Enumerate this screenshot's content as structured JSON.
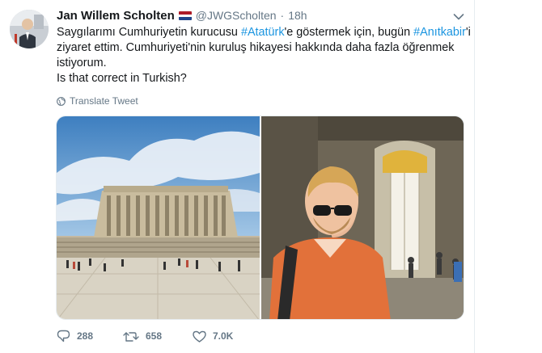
{
  "tweet": {
    "author_name": "Jan Willem Scholten",
    "handle": "@JWGScholten",
    "separator": "·",
    "time": "18h",
    "text": {
      "line1_a": "Saygılarımı Cumhuriyetin kurucusu ",
      "hashtag1": "#Atatürk",
      "line1_b": "'e göstermek için, bugün ",
      "hashtag2": "#Anıtkabir",
      "line1_c": "'i",
      "line2": "ziyaret ettim. Cumhuriyeti'nin kuruluş hikayesi hakkında daha fazla öğrenmek",
      "line3": "istiyorum.",
      "line4": "Is that correct in Turkish?"
    },
    "translate_label": "Translate Tweet",
    "media": [
      {
        "icon": "photo-anitkabir-exterior"
      },
      {
        "icon": "photo-selfie-interior"
      }
    ],
    "actions": {
      "replies": "288",
      "retweets": "658",
      "likes": "7.0K"
    }
  },
  "colors": {
    "text": "#14171a",
    "secondary": "#657786",
    "link": "#1b95e0",
    "border": "#e6ecf0"
  }
}
